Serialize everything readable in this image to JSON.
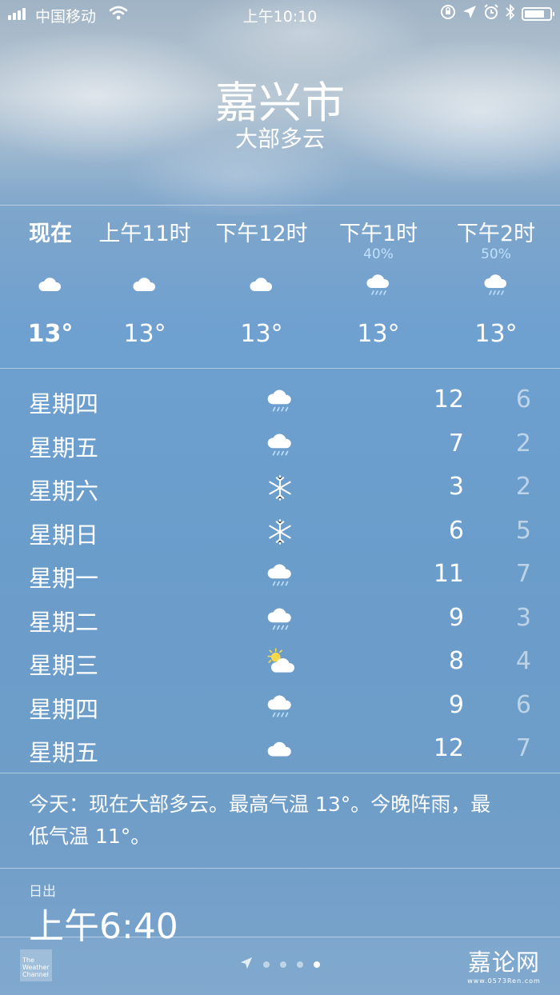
{
  "status_bar": {
    "carrier": "中国移动",
    "time": "上午10:10"
  },
  "header": {
    "city": "嘉兴市",
    "condition": "大部多云"
  },
  "hourly": [
    {
      "label": "现在",
      "prob": "",
      "icon": "cloud-icon",
      "temp": "13°"
    },
    {
      "label": "上午11时",
      "prob": "",
      "icon": "cloud-icon",
      "temp": "13°"
    },
    {
      "label": "下午12时",
      "prob": "",
      "icon": "cloud-icon",
      "temp": "13°"
    },
    {
      "label": "下午1时",
      "prob": "40%",
      "icon": "cloud-rain-icon",
      "temp": "13°"
    },
    {
      "label": "下午2时",
      "prob": "50%",
      "icon": "cloud-rain-icon",
      "temp": "13°"
    }
  ],
  "daily": [
    {
      "day": "星期四",
      "icon": "cloud-rain-icon",
      "high": "12",
      "low": "6"
    },
    {
      "day": "星期五",
      "icon": "cloud-rain-icon",
      "high": "7",
      "low": "2"
    },
    {
      "day": "星期六",
      "icon": "snowflake-icon",
      "high": "3",
      "low": "2"
    },
    {
      "day": "星期日",
      "icon": "snowflake-icon",
      "high": "6",
      "low": "5"
    },
    {
      "day": "星期一",
      "icon": "cloud-rain-icon",
      "high": "11",
      "low": "7"
    },
    {
      "day": "星期二",
      "icon": "cloud-rain-icon",
      "high": "9",
      "low": "3"
    },
    {
      "day": "星期三",
      "icon": "partly-sunny-icon",
      "high": "8",
      "low": "4"
    },
    {
      "day": "星期四",
      "icon": "cloud-rain-icon",
      "high": "9",
      "low": "6"
    },
    {
      "day": "星期五",
      "icon": "cloud-icon",
      "high": "12",
      "low": "7"
    }
  ],
  "summary": "今天：现在大部多云。最高气温 13°。今晚阵雨，最低气温 11°。",
  "sunrise": {
    "label": "日出",
    "value": "上午6:40"
  },
  "footer": {
    "logo_text": "The Weather Channel",
    "pages_total": 4,
    "page_active": 4,
    "watermark": "嘉论网",
    "watermark_url": "www.0573Ren.com"
  },
  "colors": {
    "precip_prob": "#bfe0ff",
    "sun": "#f7d84a"
  }
}
